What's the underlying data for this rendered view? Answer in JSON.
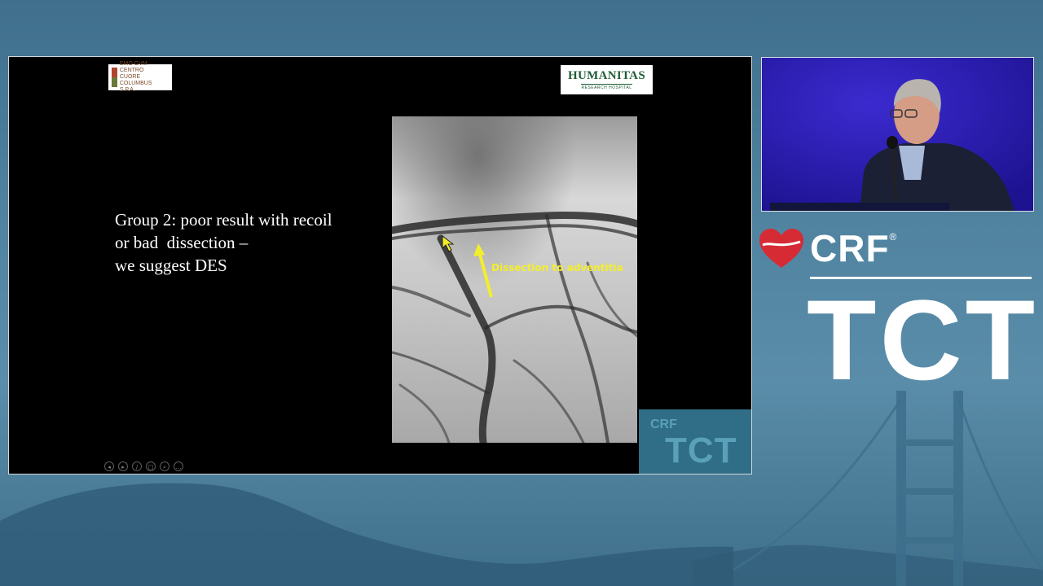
{
  "slide": {
    "logo_left": {
      "line1": "EMO GVM",
      "line2": "CENTRO",
      "line3": "CUORE COLUMBUS S.P.A."
    },
    "logo_right": {
      "name": "HUMANITAS",
      "sub": "RESEARCH HOSPITAL"
    },
    "text_lines": [
      "Group 2: poor result with recoil",
      "or bad  dissection –",
      "we suggest DES"
    ],
    "annotation": "Dissection to adventitia",
    "watermark": {
      "crf": "CRF",
      "tct": "TCT"
    },
    "controls": [
      {
        "icon": "previous-icon",
        "glyph": "◂"
      },
      {
        "icon": "next-icon",
        "glyph": "▸"
      },
      {
        "icon": "pen-icon",
        "glyph": "∕"
      },
      {
        "icon": "slides-icon",
        "glyph": "□"
      },
      {
        "icon": "zoom-icon",
        "glyph": "⌕"
      },
      {
        "icon": "more-icon",
        "glyph": "…"
      }
    ]
  },
  "brand": {
    "crf": "CRF",
    "registered": "®",
    "tct": "TCT"
  },
  "colors": {
    "annotation": "#f3ee2b",
    "brand_red": "#d62b35",
    "video_bg": "#2a1aa8"
  }
}
